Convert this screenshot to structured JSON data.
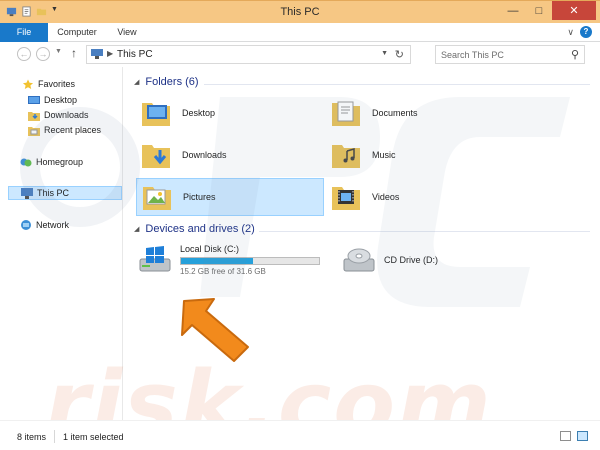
{
  "window": {
    "title": "This PC"
  },
  "ribbon": {
    "tabs": [
      "File",
      "Computer",
      "View"
    ]
  },
  "address": {
    "path": "This PC",
    "search_placeholder": "Search This PC"
  },
  "navpane": {
    "favorites": "Favorites",
    "desktop": "Desktop",
    "downloads": "Downloads",
    "recent_places": "Recent places",
    "homegroup": "Homegroup",
    "this_pc": "This PC",
    "network": "Network"
  },
  "folders": {
    "header": "Folders (6)",
    "items": [
      "Desktop",
      "Documents",
      "Downloads",
      "Music",
      "Pictures",
      "Videos"
    ]
  },
  "devices": {
    "header": "Devices and drives (2)",
    "local_disk": {
      "label": "Local Disk (C:)",
      "free_text": "15.2 GB free of 31.6 GB",
      "used_fraction": 0.52
    },
    "cd_drive": {
      "label": "CD Drive (D:)"
    }
  },
  "watermark": {
    "text": "risk.com"
  },
  "status": {
    "item_count": "8 items",
    "selection": "1 item selected"
  },
  "colors": {
    "titlebar": "#f6c784",
    "file_tab": "#1979ca",
    "group_header": "#1e3287",
    "selection": "#cce8ff",
    "arrow": "#f28a1c"
  }
}
